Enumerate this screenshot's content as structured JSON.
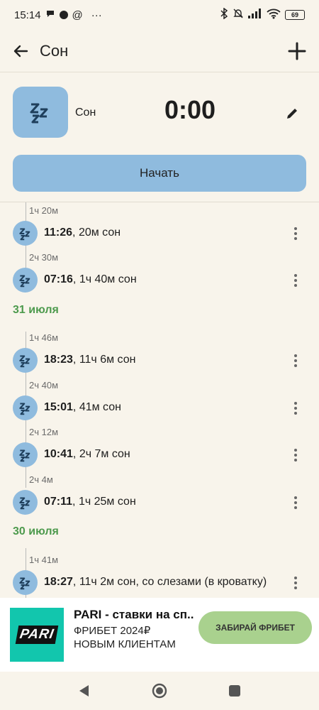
{
  "status_bar": {
    "time": "15:14",
    "extra": "@",
    "dots": "···",
    "battery": "69"
  },
  "app_bar": {
    "title": "Сон",
    "back_icon": "arrow-left-icon",
    "add_icon": "plus-icon"
  },
  "activity": {
    "name": "Сон",
    "timer": "0:00",
    "start_label": "Начать",
    "icon": "zzz-icon",
    "color": "#8fbbde"
  },
  "timeline": {
    "gaps": [
      "1ч 20м",
      "2ч 30м",
      "1ч 46м",
      "2ч 40м",
      "2ч 12м",
      "2ч 4м",
      "1ч 41м"
    ],
    "dates": [
      "31 июля",
      "30 июля"
    ],
    "entries": [
      {
        "time": "11:26",
        "rest": ", 20м сон"
      },
      {
        "time": "07:16",
        "rest": ", 1ч 40м сон"
      },
      {
        "time": "18:23",
        "rest": ", 11ч 6м сон"
      },
      {
        "time": "15:01",
        "rest": ", 41м сон"
      },
      {
        "time": "10:41",
        "rest": ", 2ч 7м сон"
      },
      {
        "time": "07:11",
        "rest": ", 1ч 25м сон"
      },
      {
        "time": "18:27",
        "rest": ", 11ч 2м сон, со слезами (в кроватку)"
      }
    ],
    "date_color": "#4d9a4d"
  },
  "ad": {
    "logo": "PARI",
    "title": "PARI - ставки на сп...",
    "line1": "ФРИБЕТ 2024₽",
    "line2": "НОВЫМ КЛИЕНТАМ",
    "button": "ЗАБИРАЙ ФРИБЕТ"
  },
  "navbar": {
    "back": "nav-back-icon",
    "home": "nav-home-icon",
    "recents": "nav-recents-icon"
  }
}
